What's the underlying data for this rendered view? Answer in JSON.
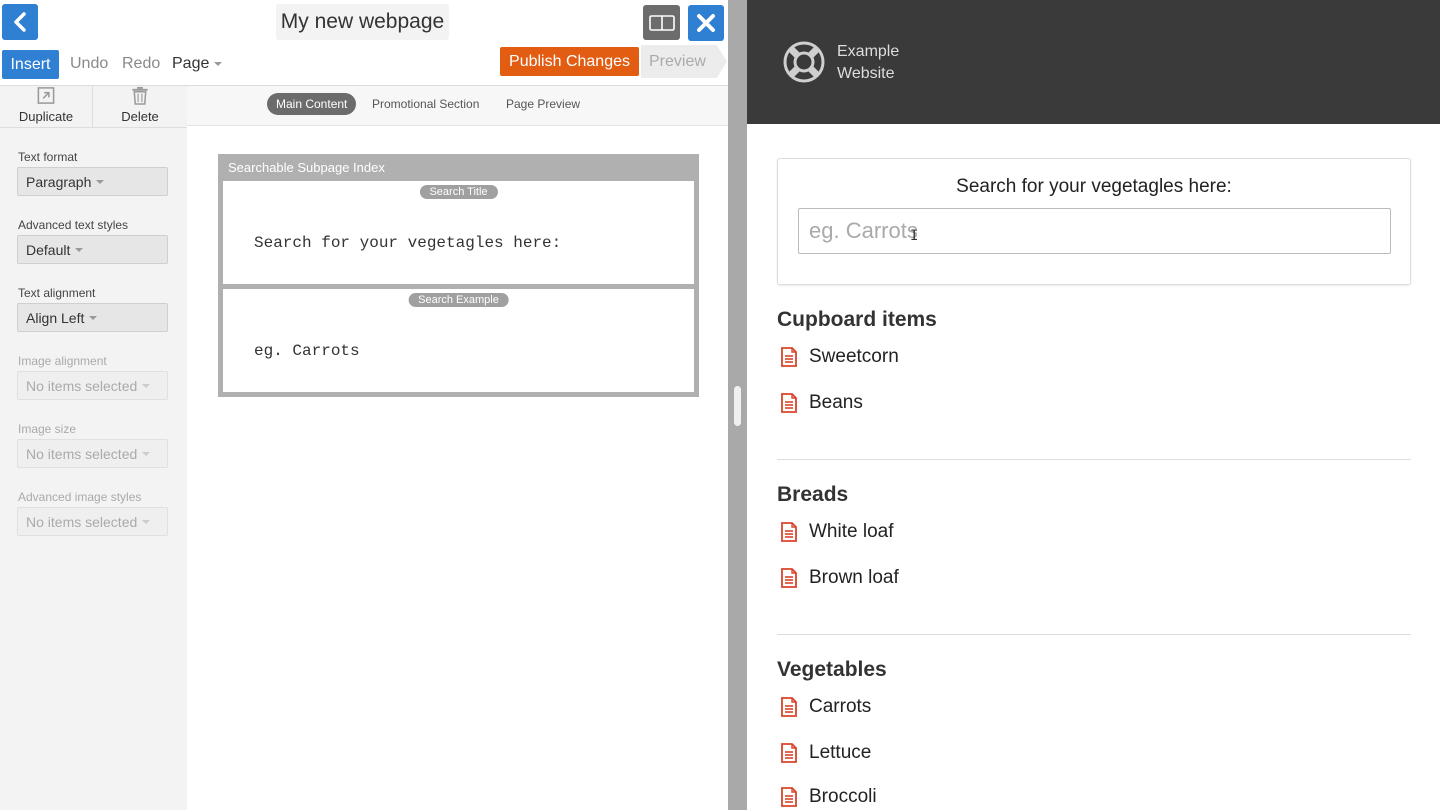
{
  "editor": {
    "page_title": "My new webpage",
    "toolbar": {
      "insert": "Insert",
      "undo": "Undo",
      "redo": "Redo",
      "page": "Page",
      "publish": "Publish Changes",
      "preview": "Preview"
    },
    "sidebar": {
      "duplicate": "Duplicate",
      "delete": "Delete",
      "fields": [
        {
          "label": "Text format",
          "value": "Paragraph",
          "enabled": true
        },
        {
          "label": "Advanced text styles",
          "value": "Default",
          "enabled": true
        },
        {
          "label": "Text alignment",
          "value": "Align Left",
          "enabled": true
        },
        {
          "label": "Image alignment",
          "value": "No items selected",
          "enabled": false
        },
        {
          "label": "Image size",
          "value": "No items selected",
          "enabled": false
        },
        {
          "label": "Advanced image styles",
          "value": "No items selected",
          "enabled": false
        }
      ]
    },
    "tabs": [
      "Main Content",
      "Promotional Section",
      "Page Preview"
    ],
    "active_tab": "Main Content",
    "widget": {
      "title": "Searchable Subpage Index",
      "search_title": {
        "label": "Search Title",
        "text": "Search for your vegetagles here:"
      },
      "search_example": {
        "label": "Search Example",
        "text": "eg. Carrots"
      }
    }
  },
  "preview": {
    "site_name_line1": "Example",
    "site_name_line2": "Website",
    "search_heading": "Search for your vegetagles here:",
    "search_placeholder": "eg. Carrots",
    "sections": [
      {
        "title": "Cupboard items",
        "items": [
          "Sweetcorn",
          "Beans"
        ]
      },
      {
        "title": "Breads",
        "items": [
          "White loaf",
          "Brown loaf"
        ]
      },
      {
        "title": "Vegetables",
        "items": [
          "Carrots",
          "Lettuce",
          "Broccoli"
        ]
      }
    ]
  },
  "colors": {
    "primary_blue": "#2f7fd3",
    "publish_orange": "#e25c12",
    "header_dark": "#3a3a3a",
    "doc_icon_red": "#d9442c"
  },
  "icons": [
    "chevron-left-icon",
    "split-view-icon",
    "close-icon",
    "duplicate-icon",
    "trash-icon",
    "lifebuoy-icon",
    "document-icon",
    "text-cursor-icon"
  ]
}
